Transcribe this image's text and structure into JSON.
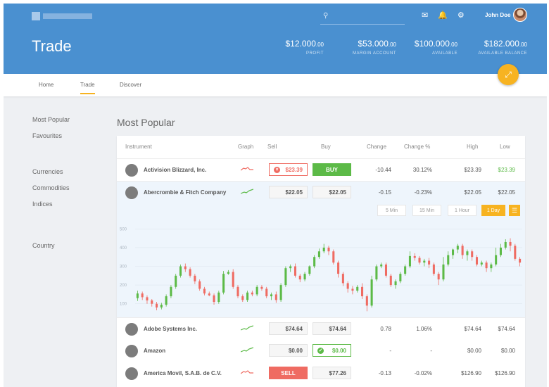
{
  "header": {
    "title": "Trade",
    "search_placeholder": "",
    "user_name": "John Doe",
    "icons": [
      "search-icon",
      "mail-icon",
      "bell-icon",
      "gear-icon"
    ],
    "stats": [
      {
        "value": "$12.000",
        "cents": ".00",
        "label": "PROFIT"
      },
      {
        "value": "$53.000",
        "cents": ".00",
        "label": "MARGIN ACCOUNT"
      },
      {
        "value": "$100.000",
        "cents": ".00",
        "label": "AVAILABLE"
      },
      {
        "value": "$182.000",
        "cents": ".00",
        "label": "AVAILABLE BALANCE"
      }
    ]
  },
  "nav": {
    "tabs": [
      "Home",
      "Trade",
      "Discover"
    ],
    "active": "Trade"
  },
  "sidebar": {
    "group1": [
      "Most Popular",
      "Favourites"
    ],
    "group2": [
      "Currencies",
      "Commodities",
      "Indices"
    ],
    "group3": [
      "Country"
    ]
  },
  "section_title": "Most Popular",
  "table": {
    "columns": [
      "Instrument",
      "Graph",
      "Sell",
      "Buy",
      "Change",
      "Change %",
      "High",
      "Low"
    ],
    "rows": [
      {
        "name": "Activision Blizzard, Inc.",
        "sell": "$23.39",
        "buy": "BUY",
        "change": "-10.44",
        "change_pct": "30.12%",
        "high": "$23.39",
        "low": "$23.39",
        "trend": "down"
      },
      {
        "name": "Abercrombie & Fitch Company",
        "sell": "$22.05",
        "buy": "$22.05",
        "change": "-0.15",
        "change_pct": "-0.23%",
        "high": "$22.05",
        "low": "$22.05",
        "trend": "up"
      },
      {
        "name": "Adobe Systems Inc.",
        "sell": "$74.64",
        "buy": "$74.64",
        "change": "0.78",
        "change_pct": "1.06%",
        "high": "$74.64",
        "low": "$74.64",
        "trend": "up"
      },
      {
        "name": "Amazon",
        "sell": "$0.00",
        "buy": "$0.00",
        "change": "-",
        "change_pct": "-",
        "high": "$0.00",
        "low": "$0.00",
        "trend": "up"
      },
      {
        "name": "America Movil, S.A.B. de C.V.",
        "sell": "SELL",
        "buy": "$77.26",
        "change": "-0.13",
        "change_pct": "-0.02%",
        "high": "$126.90",
        "low": "$126.90",
        "trend": "down"
      }
    ]
  },
  "timeframes": {
    "options": [
      "5 Min",
      "15 Min",
      "1 Hour",
      "1 Day"
    ],
    "selected": "1 Day"
  },
  "colors": {
    "brand_blue": "#4a90d0",
    "accent_orange": "#f7b321",
    "up_green": "#5cba47",
    "down_red": "#ef6b62"
  },
  "chart_data": {
    "type": "candlestick",
    "y_ticks": [
      "500",
      "400",
      "300",
      "200",
      "100"
    ],
    "ylim": [
      50,
      520
    ],
    "grid": true,
    "candles": [
      [
        130,
        155,
        170,
        115
      ],
      [
        155,
        135,
        165,
        120
      ],
      [
        135,
        118,
        145,
        100
      ],
      [
        118,
        100,
        125,
        85
      ],
      [
        100,
        80,
        110,
        65
      ],
      [
        80,
        95,
        105,
        70
      ],
      [
        95,
        140,
        150,
        85
      ],
      [
        140,
        190,
        200,
        130
      ],
      [
        190,
        250,
        260,
        180
      ],
      [
        250,
        300,
        310,
        240
      ],
      [
        300,
        285,
        315,
        270
      ],
      [
        285,
        250,
        295,
        240
      ],
      [
        250,
        220,
        260,
        205
      ],
      [
        220,
        180,
        230,
        170
      ],
      [
        180,
        155,
        190,
        145
      ],
      [
        155,
        145,
        165,
        140
      ],
      [
        145,
        110,
        155,
        95
      ],
      [
        110,
        160,
        170,
        100
      ],
      [
        160,
        260,
        275,
        150
      ],
      [
        260,
        270,
        280,
        255
      ],
      [
        270,
        190,
        285,
        180
      ],
      [
        190,
        140,
        200,
        130
      ],
      [
        140,
        120,
        150,
        110
      ],
      [
        120,
        160,
        170,
        110
      ],
      [
        160,
        150,
        170,
        140
      ],
      [
        150,
        190,
        200,
        140
      ],
      [
        190,
        180,
        200,
        170
      ],
      [
        180,
        140,
        190,
        130
      ],
      [
        140,
        150,
        160,
        120
      ],
      [
        150,
        120,
        165,
        105
      ],
      [
        120,
        200,
        210,
        110
      ],
      [
        200,
        290,
        300,
        190
      ],
      [
        290,
        300,
        310,
        270
      ],
      [
        300,
        250,
        315,
        240
      ],
      [
        250,
        230,
        260,
        215
      ],
      [
        230,
        260,
        270,
        220
      ],
      [
        260,
        300,
        305,
        250
      ],
      [
        300,
        350,
        360,
        290
      ],
      [
        350,
        380,
        395,
        340
      ],
      [
        380,
        400,
        420,
        370
      ],
      [
        400,
        380,
        410,
        360
      ],
      [
        380,
        320,
        390,
        310
      ],
      [
        320,
        260,
        330,
        240
      ],
      [
        260,
        210,
        270,
        195
      ],
      [
        210,
        180,
        220,
        160
      ],
      [
        180,
        170,
        195,
        150
      ],
      [
        170,
        190,
        200,
        160
      ],
      [
        190,
        140,
        210,
        125
      ],
      [
        140,
        90,
        150,
        60
      ],
      [
        90,
        230,
        250,
        80
      ],
      [
        230,
        300,
        310,
        220
      ],
      [
        300,
        310,
        320,
        290
      ],
      [
        310,
        250,
        320,
        240
      ],
      [
        250,
        200,
        260,
        190
      ],
      [
        200,
        220,
        230,
        180
      ],
      [
        220,
        260,
        270,
        210
      ],
      [
        260,
        300,
        310,
        250
      ],
      [
        300,
        355,
        380,
        290
      ],
      [
        355,
        345,
        370,
        330
      ],
      [
        345,
        320,
        355,
        310
      ],
      [
        320,
        330,
        340,
        300
      ],
      [
        330,
        310,
        345,
        290
      ],
      [
        310,
        260,
        320,
        250
      ],
      [
        260,
        230,
        270,
        200
      ],
      [
        230,
        310,
        350,
        220
      ],
      [
        310,
        360,
        380,
        300
      ],
      [
        360,
        390,
        395,
        340
      ],
      [
        390,
        410,
        420,
        370
      ],
      [
        410,
        360,
        420,
        340
      ],
      [
        360,
        380,
        390,
        330
      ],
      [
        380,
        350,
        390,
        330
      ],
      [
        350,
        310,
        360,
        300
      ],
      [
        310,
        320,
        330,
        300
      ],
      [
        320,
        290,
        330,
        270
      ],
      [
        290,
        310,
        320,
        270
      ],
      [
        310,
        360,
        400,
        300
      ],
      [
        360,
        400,
        420,
        350
      ],
      [
        400,
        430,
        445,
        390
      ],
      [
        430,
        410,
        450,
        380
      ],
      [
        410,
        340,
        420,
        330
      ],
      [
        340,
        320,
        350,
        300
      ]
    ]
  }
}
